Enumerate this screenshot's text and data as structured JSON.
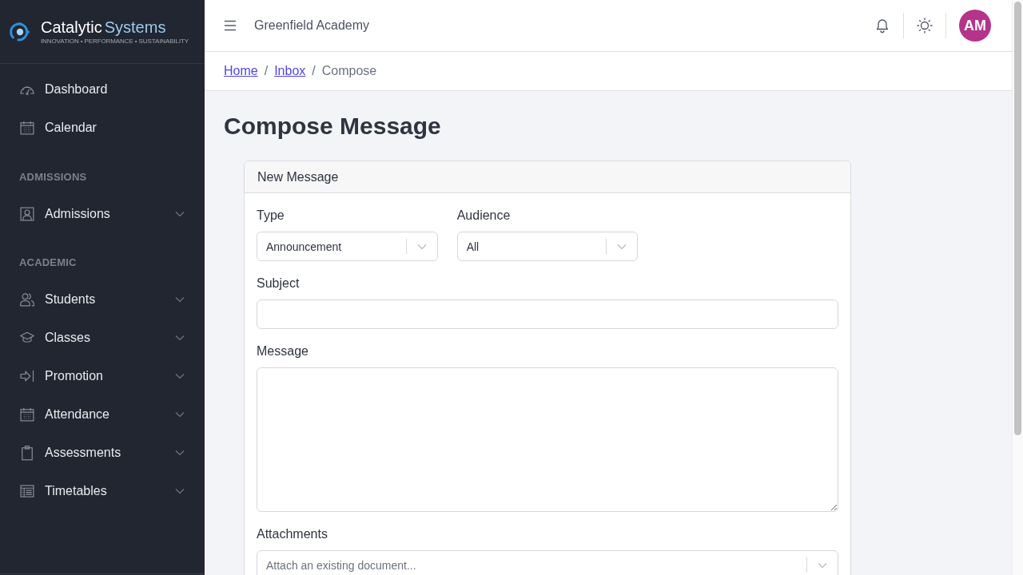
{
  "brand": {
    "name": "Catalytic",
    "name_accent": "Systems",
    "tagline": "INNOVATION • PERFORMANCE • SUSTAINABILITY"
  },
  "sidebar": {
    "sections": [
      {
        "items": [
          {
            "label": "Dashboard",
            "kind": "link"
          },
          {
            "label": "Calendar",
            "kind": "link"
          }
        ]
      },
      {
        "heading": "ADMISSIONS",
        "items": [
          {
            "label": "Admissions",
            "kind": "group"
          }
        ]
      },
      {
        "heading": "ACADEMIC",
        "items": [
          {
            "label": "Students",
            "kind": "group"
          },
          {
            "label": "Classes",
            "kind": "group"
          },
          {
            "label": "Promotion",
            "kind": "group"
          },
          {
            "label": "Attendance",
            "kind": "group"
          },
          {
            "label": "Assessments",
            "kind": "group"
          },
          {
            "label": "Timetables",
            "kind": "group"
          }
        ]
      }
    ]
  },
  "header": {
    "title": "Greenfield Academy",
    "avatar": {
      "initials": "AM"
    }
  },
  "breadcrumb": [
    {
      "kind": "link",
      "label": "Home"
    },
    {
      "kind": "separator",
      "label": "/"
    },
    {
      "kind": "link",
      "label": "Inbox"
    },
    {
      "kind": "separator",
      "label": "/"
    },
    {
      "kind": "current",
      "label": "Compose"
    }
  ],
  "page_title": "Compose Message",
  "card": {
    "title": "New Message",
    "rows": [
      [
        {
          "kind": "select",
          "label": "Type",
          "value": "Announcement"
        },
        {
          "kind": "select",
          "label": "Audience",
          "value": "All"
        }
      ],
      [
        {
          "kind": "text",
          "label": "Subject"
        }
      ],
      [
        {
          "kind": "textarea",
          "label": "Message"
        }
      ],
      [
        {
          "kind": "select",
          "label": "Attachments",
          "placeholder": "Attach an existing document..."
        }
      ]
    ]
  }
}
